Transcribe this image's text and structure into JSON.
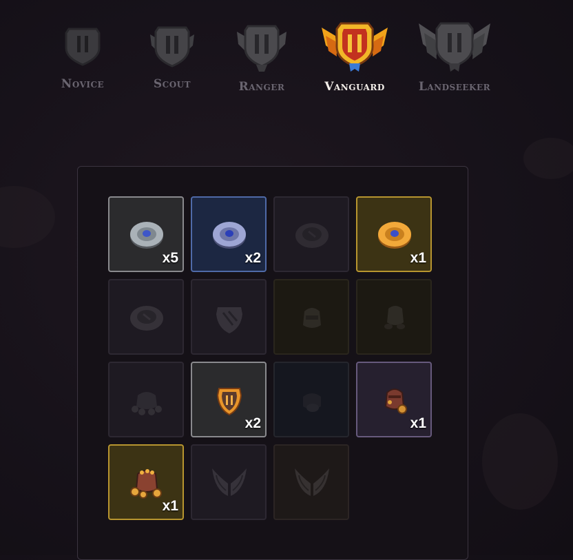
{
  "ranks": [
    {
      "label": "Novice",
      "active": false
    },
    {
      "label": "Scout",
      "active": false
    },
    {
      "label": "Ranger",
      "active": false
    },
    {
      "label": "Vanguard",
      "active": true
    },
    {
      "label": "Landseeker",
      "active": false
    }
  ],
  "rewards": [
    {
      "icon": "silver-coin-icon",
      "count": "x5",
      "rarity": "grey",
      "state": "owned"
    },
    {
      "icon": "blue-coin-icon",
      "count": "x2",
      "rarity": "blue",
      "state": "owned"
    },
    {
      "icon": "coin-icon",
      "count": "",
      "rarity": "dark",
      "state": "locked"
    },
    {
      "icon": "gold-coin-icon",
      "count": "x1",
      "rarity": "gold",
      "state": "owned"
    },
    {
      "icon": "coin-icon",
      "count": "",
      "rarity": "dark",
      "state": "locked"
    },
    {
      "icon": "shield-icon",
      "count": "",
      "rarity": "dark",
      "state": "locked"
    },
    {
      "icon": "pouch-icon",
      "count": "",
      "rarity": "brown",
      "state": "locked"
    },
    {
      "icon": "pouch-icon",
      "count": "",
      "rarity": "brown",
      "state": "locked"
    },
    {
      "icon": "coin-pile-icon",
      "count": "",
      "rarity": "dark",
      "state": "locked"
    },
    {
      "icon": "orange-shield-icon",
      "count": "x2",
      "rarity": "grey",
      "state": "owned"
    },
    {
      "icon": "pouch-icon",
      "count": "",
      "rarity": "navy",
      "state": "locked"
    },
    {
      "icon": "coin-bag-icon",
      "count": "x1",
      "rarity": "purple",
      "state": "owned"
    },
    {
      "icon": "coin-bag-icon",
      "count": "x1",
      "rarity": "gold",
      "state": "owned"
    },
    {
      "icon": "wings-icon",
      "count": "",
      "rarity": "dark",
      "state": "locked"
    },
    {
      "icon": "wings-icon",
      "count": "",
      "rarity": "reddark",
      "state": "locked"
    }
  ]
}
